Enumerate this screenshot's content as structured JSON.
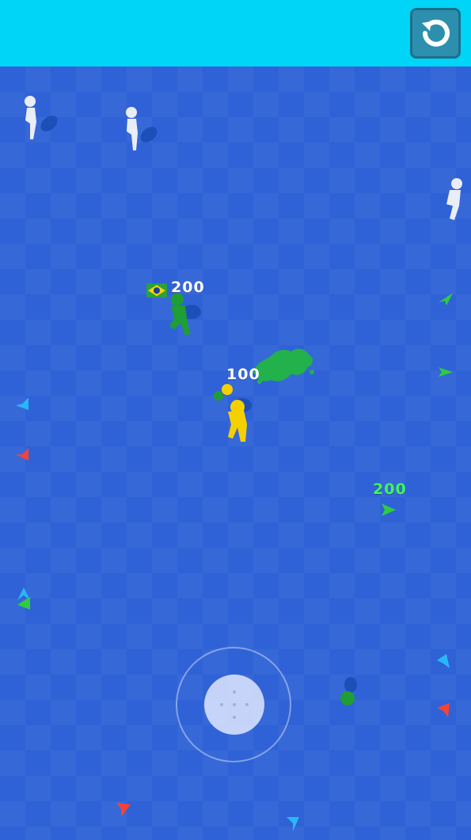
{
  "hud": {
    "restart_button": {
      "icon": "restart-icon",
      "color": "#2d8fae"
    }
  },
  "players": [
    {
      "id": "enemy-green",
      "score": "200",
      "has_flag": true
    },
    {
      "id": "player-yellow",
      "score": "100"
    },
    {
      "id": "offscreen-green",
      "score": "200"
    }
  ],
  "colors": {
    "top_bar": "#00d4f7",
    "arena": "#2f62d6",
    "green_team": "#1e9e34",
    "yellow_player": "#f5d000",
    "neutral": "#e9edf5"
  },
  "joystick": {
    "icon": "joystick-icon"
  }
}
